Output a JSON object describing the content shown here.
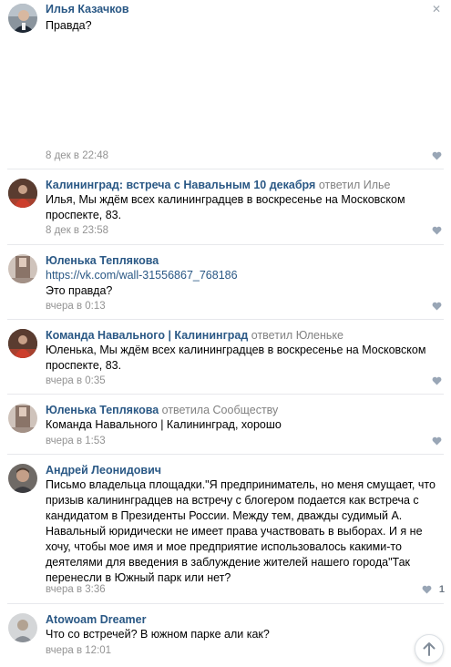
{
  "comments": [
    {
      "author": "Илья Казачков",
      "reply_to": "",
      "text": "Правда?",
      "date": "8 дек в 22:48",
      "likes": ""
    },
    {
      "author": "Калининград: встреча с Навальным 10 декабря",
      "reply_to": "ответил Илье",
      "text": "Илья, Мы ждём всех калининградцев в воскресенье на Московском проспекте, 83.",
      "date": "8 дек в 23:58",
      "likes": ""
    },
    {
      "author": "Юленька Теплякова",
      "reply_to": "",
      "link": "https://vk.com/wall-31556867_768186",
      "text": "Это правда?",
      "date": "вчера в 0:13",
      "likes": ""
    },
    {
      "author": "Команда Навального | Калининград",
      "reply_to": "ответил Юленьке",
      "text": "Юленька, Мы ждём всех калининградцев в воскресенье на Московском проспекте, 83.",
      "date": "вчера в 0:35",
      "likes": ""
    },
    {
      "author": "Юленька Теплякова",
      "reply_to": "ответила Сообществу",
      "text": "Команда Навального | Калининград, хорошо",
      "date": "вчера в 1:53",
      "likes": ""
    },
    {
      "author": "Андрей Леонидович",
      "reply_to": "",
      "text": "Письмо владельца площадки.\"Я предприниматель, но меня смущает, что призыв калининградцев на встречу с блогером подается как встреча с кандидатом в Президенты России. Между тем, дважды судимый А. Навальный юридически не имеет права участвовать в выборах. И я не хочу, чтобы мое имя и мое предприятие использовалось какими-то деятелями для введения в заблуждение жителей нашего города\"Так перенесли в Южный парк или нет?",
      "date": "вчера в 3:36",
      "likes": "1"
    },
    {
      "author": "Atowoam Dreamer",
      "reply_to": "",
      "text": "Что со встречей? В южном парке али как?",
      "date": "вчера в 12:01",
      "likes": ""
    }
  ],
  "icons": {
    "close": "close-icon",
    "like": "heart-icon",
    "scroll": "arrow-up-icon"
  },
  "colors": {
    "author": "#2a5885",
    "meta": "#939393",
    "divider": "#e7e8ec",
    "heart": "#99a6b6"
  }
}
